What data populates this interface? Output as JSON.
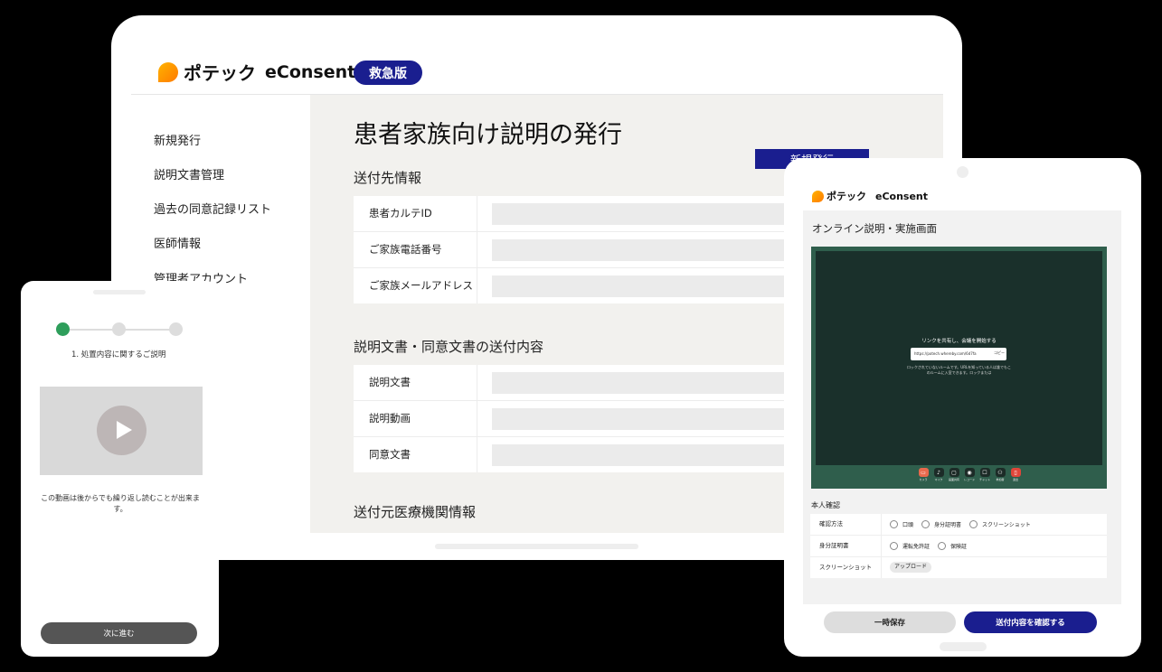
{
  "laptop": {
    "brand_jp": "ポテック",
    "brand_en": "eConsent",
    "badge": "救急版",
    "nav": [
      "新規発行",
      "説明文書管理",
      "過去の同意記録リスト",
      "医師情報",
      "管理者アカウント"
    ],
    "page_title": "患者家族向け説明の発行",
    "new_button": "新規発行",
    "sections": [
      {
        "title": "送付先情報",
        "fields": [
          "患者カルテID",
          "ご家族電話番号",
          "ご家族メールアドレス"
        ]
      },
      {
        "title": "説明文書・同意文書の送付内容",
        "fields": [
          "説明文書",
          "説明動画",
          "同意文書"
        ]
      },
      {
        "title": "送付元医療機関情報"
      }
    ]
  },
  "phone": {
    "step_label": "1. 処置内容に関するご説明",
    "video_note": "この動画は後からでも繰り返し読むことが出来ます。",
    "next_button": "次に進む"
  },
  "tablet": {
    "brand_jp": "ポテック",
    "brand_en": "eConsent",
    "title": "オンライン説明・実施画面",
    "video_call": {
      "heading": "リンクを共有し、会議を開始する",
      "url": "https://potech.whereby.com/6d7fa",
      "copy": "コピー",
      "note": "ロックされていないルームです。URLを知っている人は誰でもこのルームに入室できます。ロックまたは",
      "controls": [
        "カメラ",
        "マイク",
        "画面共有",
        "レコード",
        "チャット",
        "参加者",
        "退出"
      ]
    },
    "identity": {
      "heading": "本人確認",
      "method_label": "確認方法",
      "methods": [
        "口頭",
        "身分証明書",
        "スクリーンショット"
      ],
      "id_label": "身分証明書",
      "ids": [
        "運転免許証",
        "保険証"
      ],
      "screenshot_label": "スクリーンショット",
      "upload": "アップロード"
    },
    "save_button": "一時保存",
    "confirm_button": "送付内容を確認する"
  }
}
